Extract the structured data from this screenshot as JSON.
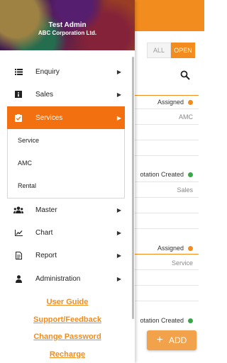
{
  "background": {
    "tabs": [
      {
        "label": "ALL",
        "active": false
      },
      {
        "label": "OPEN",
        "active": true
      }
    ],
    "rows": [
      {
        "status": "Assigned",
        "status_color": "#f28c1e",
        "sub": "AMC"
      },
      {
        "status": "otation Created",
        "status_color": "#3aa64a",
        "sub": "Sales"
      },
      {
        "status": "Assigned",
        "status_color": "#f28c1e",
        "sub": "Service"
      },
      {
        "status": "otation Created",
        "status_color": "#3aa64a",
        "sub": ""
      }
    ],
    "add_button": {
      "icon": "plus-icon",
      "label": "ADD"
    }
  },
  "drawer": {
    "user_name": "Test Admin",
    "company": "ABC Corporation Ltd.",
    "menu": [
      {
        "label": "Enquiry",
        "icon": "list-icon",
        "active": false
      },
      {
        "label": "Sales",
        "icon": "info-icon",
        "active": false
      },
      {
        "label": "Services",
        "icon": "clipboard-check-icon",
        "active": true
      },
      {
        "label": "Master",
        "icon": "group-icon",
        "active": false
      },
      {
        "label": "Chart",
        "icon": "line-chart-icon",
        "active": false
      },
      {
        "label": "Report",
        "icon": "document-icon",
        "active": false
      },
      {
        "label": "Administration",
        "icon": "person-icon",
        "active": false
      }
    ],
    "submenu": [
      {
        "label": "Service"
      },
      {
        "label": "AMC"
      },
      {
        "label": "Rental"
      }
    ],
    "links": [
      {
        "label": "User Guide"
      },
      {
        "label": "Support/Feedback"
      },
      {
        "label": "Change Password"
      },
      {
        "label": "Recharge"
      }
    ]
  },
  "colors": {
    "accent": "#f28c1e",
    "active_item": "#f2700f",
    "success": "#3aa64a"
  }
}
